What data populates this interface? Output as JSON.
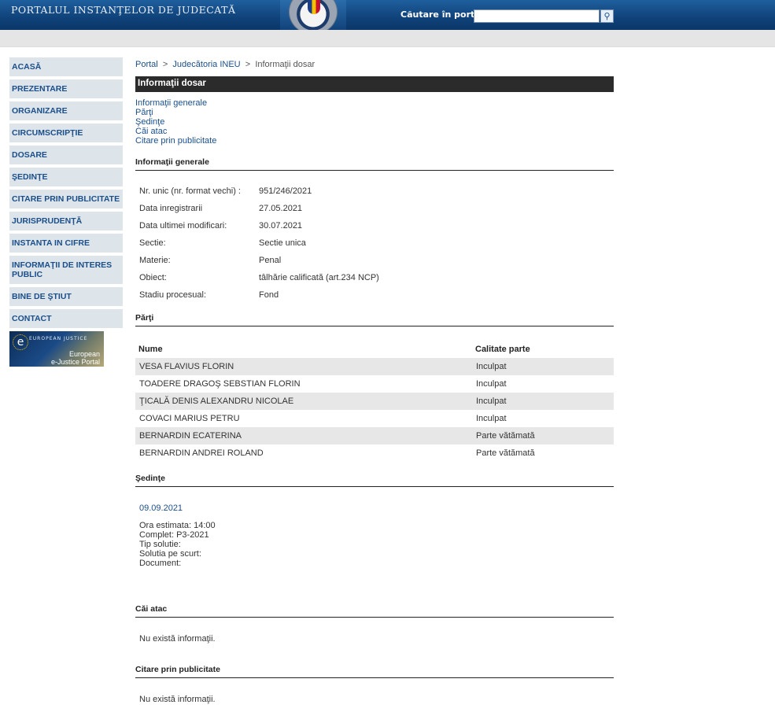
{
  "header": {
    "portal_title": "PORTALUL INSTANŢELOR DE JUDECATĂ",
    "search_label": "Căutare în portal",
    "search_value": "",
    "search_button_icon": "search-icon"
  },
  "sidebar": {
    "items": [
      {
        "label": "ACASĂ"
      },
      {
        "label": "PREZENTARE"
      },
      {
        "label": "ORGANIZARE"
      },
      {
        "label": "CIRCUMSCRIPŢIE"
      },
      {
        "label": "DOSARE"
      },
      {
        "label": "ŞEDINŢE"
      },
      {
        "label": "CITARE PRIN PUBLICITATE"
      },
      {
        "label": "JURISPRUDENŢĂ"
      },
      {
        "label": "INSTANTA IN CIFRE"
      },
      {
        "label": "INFORMAŢII DE INTERES PUBLIC"
      },
      {
        "label": "BINE DE ŞTIUT"
      },
      {
        "label": "CONTACT"
      }
    ],
    "banner": {
      "small_text": "EUROPEAN JUSTICE",
      "line1": "European",
      "line2": "e-Justice Portal"
    }
  },
  "breadcrumb": {
    "items": [
      "Portal",
      "Judecătoria INEU",
      "Informaţii dosar"
    ],
    "separator": ">"
  },
  "page_title": "Informaţii dosar",
  "toc": [
    "Informaţii generale",
    "Părţi",
    "Şedinţe",
    "Căi atac",
    "Citare prin publicitate"
  ],
  "general": {
    "title": "Informaţii generale",
    "rows": [
      {
        "label": "Nr. unic (nr. format vechi) :",
        "value": "951/246/2021"
      },
      {
        "label": "Data inregistrarii",
        "value": "27.05.2021"
      },
      {
        "label": "Data ultimei modificari:",
        "value": "30.07.2021"
      },
      {
        "label": "Sectie:",
        "value": "Sectie unica"
      },
      {
        "label": "Materie:",
        "value": "Penal"
      },
      {
        "label": "Obiect:",
        "value": "tâlhărie calificată (art.234 NCP)"
      },
      {
        "label": "Stadiu procesual:",
        "value": "Fond"
      }
    ]
  },
  "parti": {
    "title": "Părţi",
    "headers": [
      "Nume",
      "Calitate parte"
    ],
    "rows": [
      {
        "name": "VESA FLAVIUS FLORIN",
        "role": "Inculpat"
      },
      {
        "name": "TOADERE DRAGOŞ SEBSTIAN FLORIN",
        "role": "Inculpat"
      },
      {
        "name": "ŢICALĂ DENIS ALEXANDRU NICOLAE",
        "role": "Inculpat"
      },
      {
        "name": "COVACI MARIUS PETRU",
        "role": "Inculpat"
      },
      {
        "name": "BERNARDIN ECATERINA",
        "role": "Parte vătămată"
      },
      {
        "name": "BERNARDIN ANDREI ROLAND",
        "role": "Parte vătămată"
      }
    ]
  },
  "sedinte": {
    "title": "Şedinţe",
    "date": "09.09.2021",
    "details": [
      "Ora estimata: 14:00",
      "Complet: P3-2021",
      "Tip solutie:",
      "Solutia pe scurt:",
      "Document:"
    ]
  },
  "cai_atac": {
    "title": "Căi atac",
    "empty_text": "Nu există informaţii."
  },
  "citare": {
    "title": "Citare prin publicitate",
    "empty_text": "Nu există informaţii."
  }
}
